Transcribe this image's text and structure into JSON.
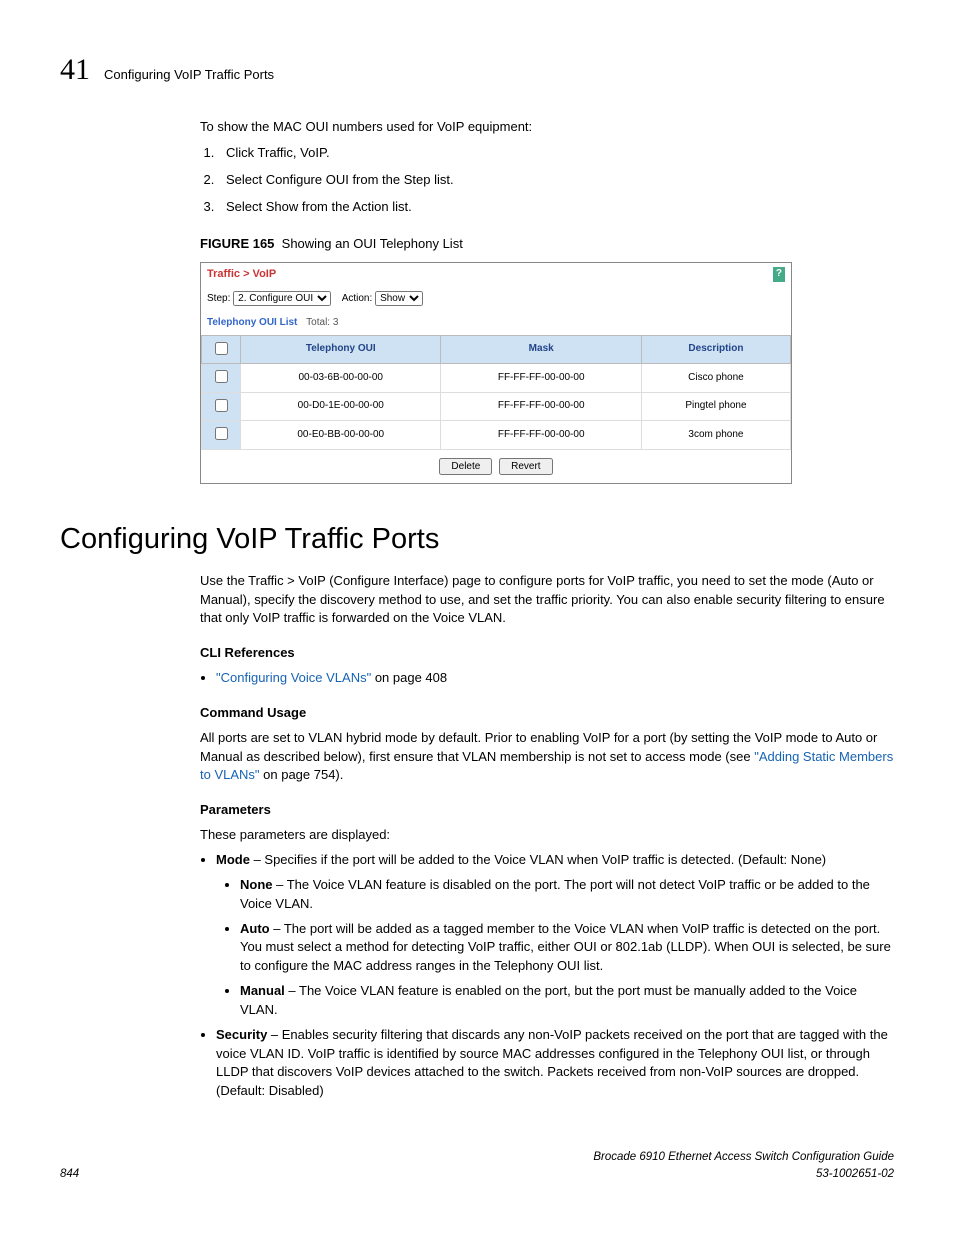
{
  "header": {
    "chapter_number": "41",
    "chapter_title": "Configuring VoIP Traffic Ports"
  },
  "intro": "To show the MAC OUI numbers used for VoIP equipment:",
  "steps": [
    "Click Traffic, VoIP.",
    "Select Configure OUI from the Step list.",
    "Select Show from the Action list."
  ],
  "figure": {
    "label": "FIGURE 165",
    "caption": "Showing an OUI Telephony List"
  },
  "screenshot": {
    "breadcrumb": "Traffic > VoIP",
    "step_label": "Step:",
    "step_value": "2. Configure OUI",
    "action_label": "Action:",
    "action_value": "Show",
    "list_title": "Telephony OUI List",
    "list_total_label": "Total:",
    "list_total_value": "3",
    "columns": [
      "Telephony OUI",
      "Mask",
      "Description"
    ],
    "rows": [
      {
        "oui": "00-03-6B-00-00-00",
        "mask": "FF-FF-FF-00-00-00",
        "desc": "Cisco phone"
      },
      {
        "oui": "00-D0-1E-00-00-00",
        "mask": "FF-FF-FF-00-00-00",
        "desc": "Pingtel phone"
      },
      {
        "oui": "00-E0-BB-00-00-00",
        "mask": "FF-FF-FF-00-00-00",
        "desc": "3com phone"
      }
    ],
    "buttons": {
      "delete": "Delete",
      "revert": "Revert"
    }
  },
  "section_heading": "Configuring VoIP Traffic Ports",
  "section_intro": "Use the Traffic > VoIP (Configure Interface) page to configure ports for VoIP traffic, you need to set the mode (Auto or Manual), specify the discovery method to use, and set the traffic priority. You can also enable security filtering to ensure that only VoIP traffic is forwarded on the Voice VLAN.",
  "cli_refs": {
    "heading": "CLI References",
    "link_text": "\"Configuring Voice VLANs\"",
    "link_suffix": " on page 408"
  },
  "command_usage": {
    "heading": "Command Usage",
    "text_before": "All ports are set to VLAN hybrid mode by default. Prior to enabling VoIP for a port (by setting the VoIP mode to Auto or Manual as described below), first ensure that VLAN membership is not set to access mode (see ",
    "link_text": "\"Adding Static Members to VLANs\"",
    "text_after": " on page 754)."
  },
  "parameters": {
    "heading": "Parameters",
    "intro": "These parameters are displayed:",
    "mode": {
      "label": "Mode",
      "desc": " – Specifies if the port will be added to the Voice VLAN when VoIP traffic is detected. (Default: None)",
      "none": {
        "label": "None",
        "desc": " – The Voice VLAN feature is disabled on the port. The port will not detect VoIP traffic or be added to the Voice VLAN."
      },
      "auto": {
        "label": "Auto",
        "desc": " – The port will be added as a tagged member to the Voice VLAN when VoIP traffic is detected on the port. You must select a method for detecting VoIP traffic, either OUI or 802.1ab (LLDP). When OUI is selected, be sure to configure the MAC address ranges in the Telephony OUI list."
      },
      "manual": {
        "label": "Manual",
        "desc": " – The Voice VLAN feature is enabled on the port, but the port must be manually added to the Voice VLAN."
      }
    },
    "security": {
      "label": "Security",
      "desc": " – Enables security filtering that discards any non-VoIP packets received on the port that are tagged with the voice VLAN ID. VoIP traffic is identified by source MAC addresses configured in the Telephony OUI list, or through LLDP that discovers VoIP devices attached to the switch. Packets received from non-VoIP sources are dropped. (Default: Disabled)"
    }
  },
  "footer": {
    "page": "844",
    "doc_title": "Brocade 6910 Ethernet Access Switch Configuration Guide",
    "doc_id": "53-1002651-02"
  }
}
